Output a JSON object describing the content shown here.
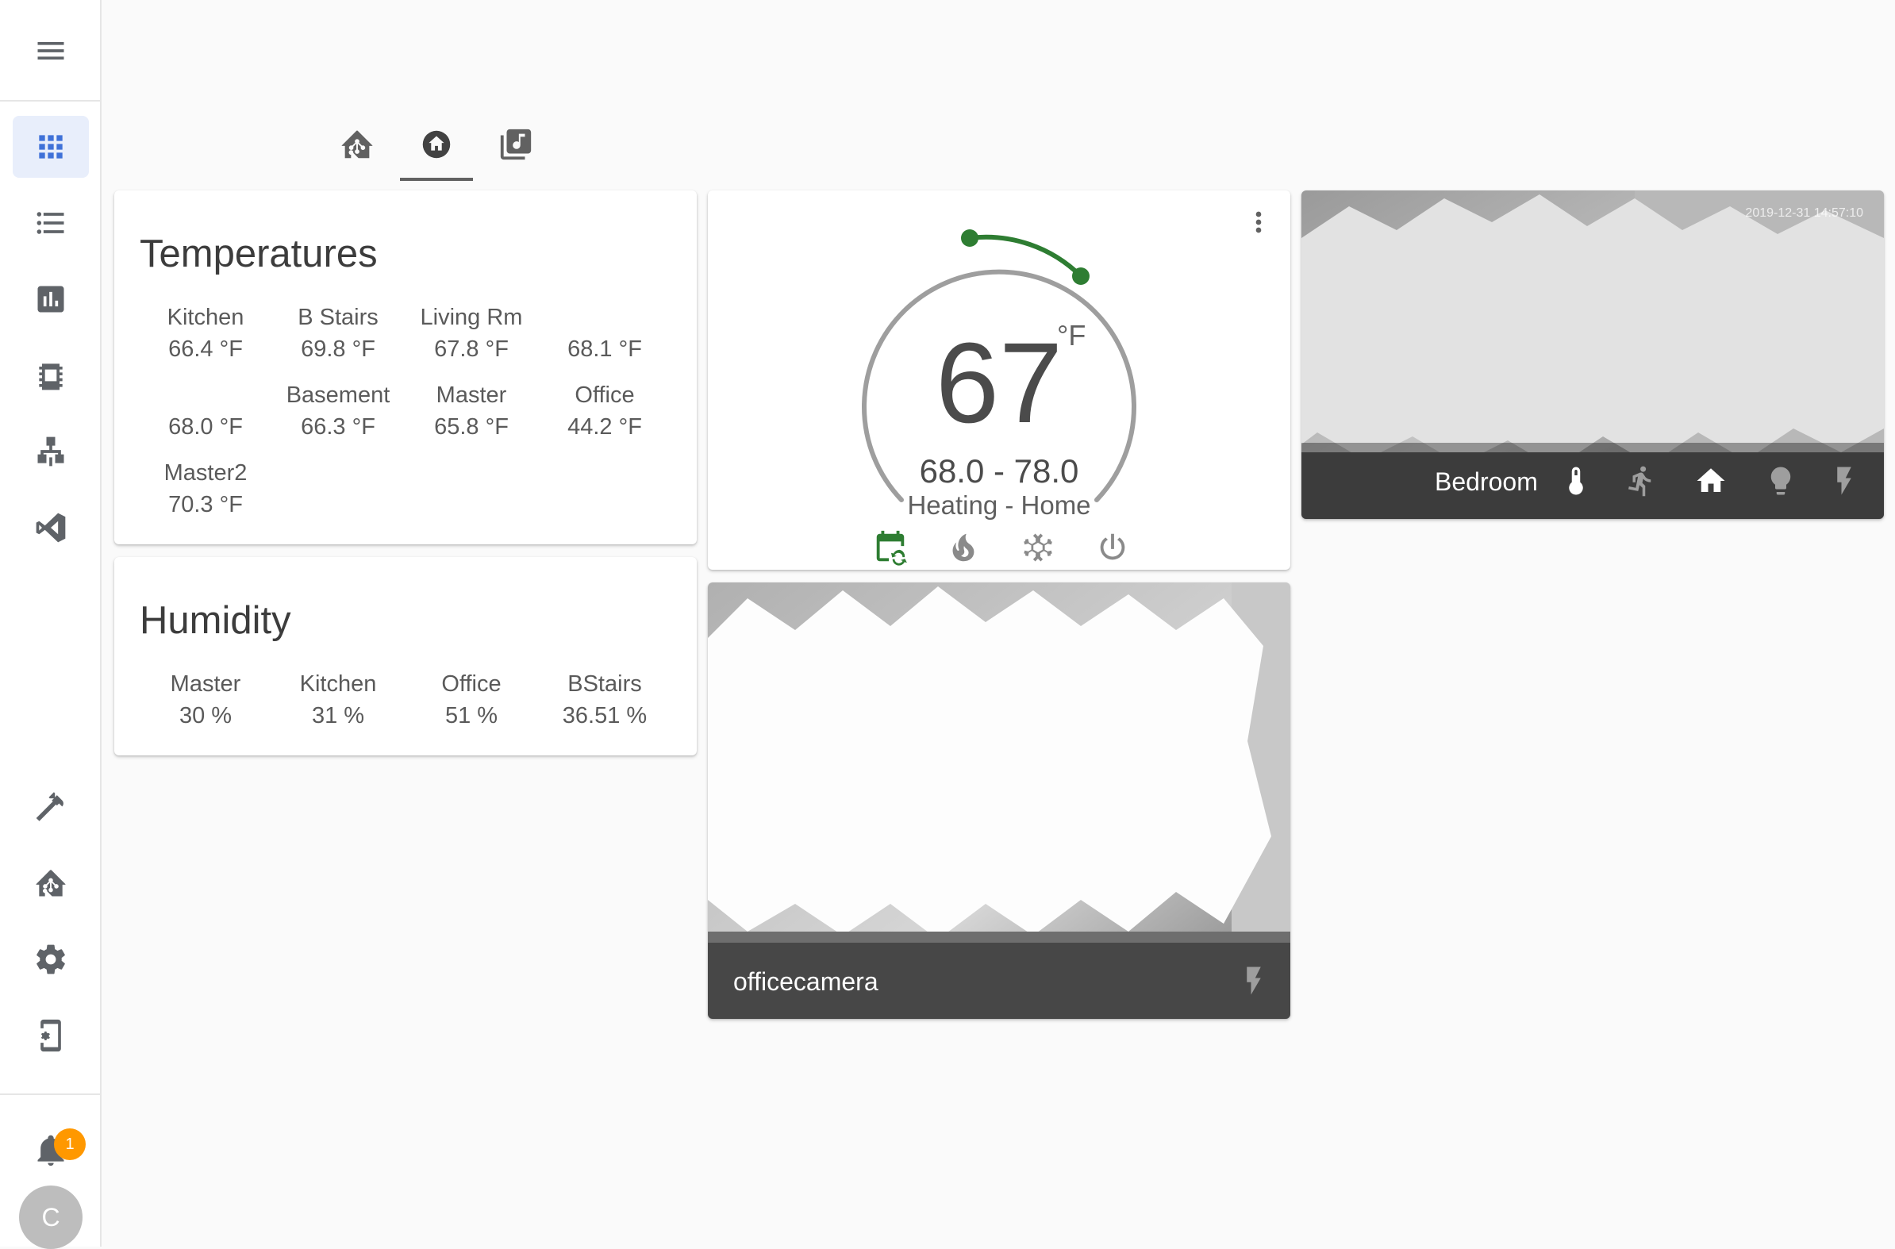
{
  "sidebar": {
    "items": [
      {
        "name": "overview",
        "icon": "view-grid-icon",
        "active": true
      },
      {
        "name": "logbook",
        "icon": "list-icon"
      },
      {
        "name": "history",
        "icon": "chart-bar-icon"
      },
      {
        "name": "dashboard-node",
        "icon": "chip-icon"
      },
      {
        "name": "zwave",
        "icon": "sitemap-icon"
      },
      {
        "name": "vscode",
        "icon": "vscode-icon"
      }
    ],
    "bottom_items": [
      {
        "name": "developer-tools",
        "icon": "hammer-icon"
      },
      {
        "name": "hacs",
        "icon": "home-assistant-icon"
      },
      {
        "name": "configuration",
        "icon": "gear-icon"
      },
      {
        "name": "device-settings",
        "icon": "cellphone-cog-icon"
      }
    ],
    "notification_count": "1",
    "user_initial": "C"
  },
  "header": {
    "tabs": [
      {
        "icon": "home-assistant-icon"
      },
      {
        "icon": "home-icon",
        "active": true
      },
      {
        "icon": "music-box-icon"
      }
    ]
  },
  "temperatures": {
    "title": "Temperatures",
    "sensors": [
      {
        "name": "Kitchen",
        "value": "66.4 °F"
      },
      {
        "name": "B Stairs",
        "value": "69.8 °F"
      },
      {
        "name": "Living Rm",
        "value": "67.8 °F"
      },
      {
        "name": "",
        "value": "68.1 °F"
      },
      {
        "name": "",
        "value": "68.0 °F"
      },
      {
        "name": "Basement",
        "value": "66.3 °F"
      },
      {
        "name": "Master",
        "value": "65.8 °F"
      },
      {
        "name": "Office",
        "value": "44.2 °F"
      },
      {
        "name": "Master2",
        "value": "70.3 °F"
      }
    ]
  },
  "humidity": {
    "title": "Humidity",
    "sensors": [
      {
        "name": "Master",
        "value": "30 %"
      },
      {
        "name": "Kitchen",
        "value": "31 %"
      },
      {
        "name": "Office",
        "value": "51 %"
      },
      {
        "name": "BStairs",
        "value": "36.51 %"
      }
    ]
  },
  "thermostat": {
    "current": "67",
    "unit": "°F",
    "range": "68.0 - 78.0",
    "mode": "Heating - Home",
    "modes": [
      {
        "name": "auto",
        "icon": "calendar-sync-icon",
        "active": true
      },
      {
        "name": "heat",
        "icon": "fire-icon"
      },
      {
        "name": "cool",
        "icon": "snowflake-icon"
      },
      {
        "name": "off",
        "icon": "power-icon"
      }
    ],
    "accent": "#2e7d32"
  },
  "cameras": [
    {
      "name": "Bedroom",
      "timestamp": "2019-12-31 14:57:10",
      "actions": [
        "thermometer-icon",
        "motion-icon",
        "home-icon",
        "lightbulb-icon",
        "flash-icon"
      ]
    },
    {
      "name": "officecamera",
      "actions": [
        "flash-icon"
      ]
    }
  ]
}
